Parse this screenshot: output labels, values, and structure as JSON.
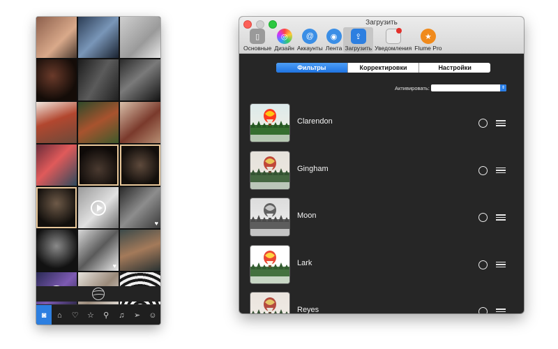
{
  "left_app": {
    "tabs": [
      {
        "icon": "camera-icon",
        "glyph": "◙",
        "active": true
      },
      {
        "icon": "home-icon",
        "glyph": "⌂",
        "active": false
      },
      {
        "icon": "heart-icon",
        "glyph": "♡",
        "active": false
      },
      {
        "icon": "star-icon",
        "glyph": "☆",
        "active": false
      },
      {
        "icon": "search-icon",
        "glyph": "⚲",
        "active": false
      },
      {
        "icon": "bell-icon",
        "glyph": "♫",
        "active": false
      },
      {
        "icon": "send-icon",
        "glyph": "➢",
        "active": false
      },
      {
        "icon": "profile-icon",
        "glyph": "☺",
        "active": false
      }
    ]
  },
  "window": {
    "title": "Загрузить",
    "toolbar": [
      {
        "label": "Основные",
        "icon": "phone-icon",
        "color": "#9a9a9a"
      },
      {
        "label": "Дизайн",
        "icon": "color-wheel-icon",
        "color": "#e0508a"
      },
      {
        "label": "Аккаунты",
        "icon": "at-icon",
        "color": "#3a8ee6"
      },
      {
        "label": "Лента",
        "icon": "broadcast-icon",
        "color": "#3a8ee6"
      },
      {
        "label": "Загрузить",
        "icon": "upload-icon",
        "color": "#2d7fe0"
      },
      {
        "label": "Уведомления",
        "icon": "notification-icon",
        "color": "#e8e8e8"
      },
      {
        "label": "Flume Pro",
        "icon": "pro-star-icon",
        "color": "#f08a1c"
      }
    ],
    "segments": [
      "Фильтры",
      "Корректировки",
      "Настройки"
    ],
    "active_segment": "Фильтры",
    "activate_label": "Активировать:",
    "activate_value": "",
    "filters": [
      {
        "name": "Clarendon",
        "tone": "vivid"
      },
      {
        "name": "Gingham",
        "tone": "faded"
      },
      {
        "name": "Moon",
        "tone": "mono"
      },
      {
        "name": "Lark",
        "tone": "bright"
      },
      {
        "name": "Reyes",
        "tone": "soft"
      }
    ]
  }
}
